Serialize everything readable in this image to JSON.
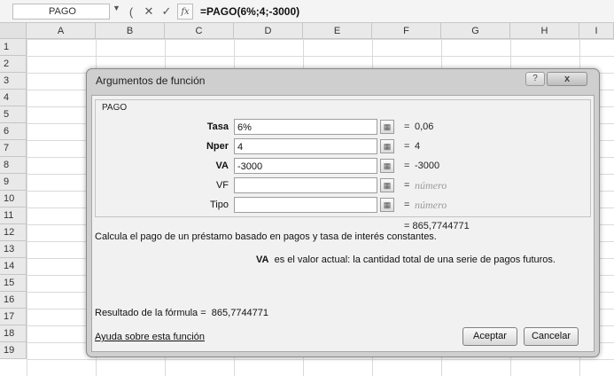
{
  "formula_bar": {
    "name_box": "PAGO",
    "cancel_symbol": "✕",
    "enter_symbol": "✓",
    "fx_symbol": "fx",
    "formula": "=PAGO(6%;4;-3000)"
  },
  "grid": {
    "columns": [
      "A",
      "B",
      "C",
      "D",
      "E",
      "F",
      "G",
      "H",
      "I"
    ],
    "rows": [
      "1",
      "2",
      "3",
      "4",
      "5",
      "6",
      "7",
      "8",
      "9",
      "10",
      "11",
      "12",
      "13",
      "14",
      "15",
      "16",
      "17",
      "18",
      "19"
    ]
  },
  "dialog": {
    "title": "Argumentos de función",
    "help_symbol": "?",
    "close_symbol": "x",
    "function_name": "PAGO",
    "arguments": [
      {
        "label": "Tasa",
        "value": "6%",
        "eq": "=",
        "result": "0,06",
        "required": true
      },
      {
        "label": "Nper",
        "value": "4",
        "eq": "=",
        "result": "4",
        "required": true
      },
      {
        "label": "VA",
        "value": "-3000",
        "eq": "=",
        "result": "-3000",
        "required": true
      },
      {
        "label": "VF",
        "value": "",
        "eq": "=",
        "result": "número",
        "required": false
      },
      {
        "label": "Tipo",
        "value": "",
        "eq": "=",
        "result": "número",
        "required": false
      }
    ],
    "inline_result": "= 865,7744771",
    "description": "Calcula el pago de un préstamo basado en pagos y tasa de interés constantes.",
    "arg_desc_name": "VA",
    "arg_desc_text": "es el valor actual: la cantidad total de una serie de pagos futuros.",
    "formula_result_label": "Resultado de la fórmula =",
    "formula_result_value": "865,7744771",
    "help_link": "Ayuda sobre esta función",
    "ok_label": "Aceptar",
    "cancel_label": "Cancelar"
  }
}
